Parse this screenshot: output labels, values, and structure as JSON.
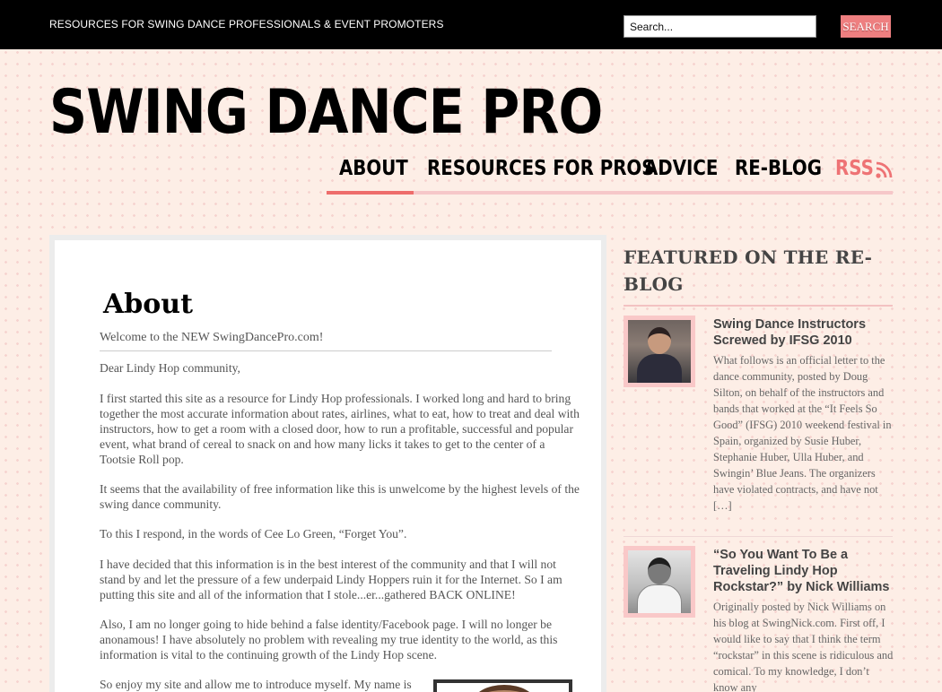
{
  "header": {
    "tagline": "RESOURCES FOR SWING DANCE PROFESSIONALS & EVENT PROMOTERS",
    "search_placeholder": "Search...",
    "search_button": "SEARCH"
  },
  "site": {
    "title": "SWING DANCE PRO"
  },
  "nav": {
    "items": [
      {
        "label": "ABOUT",
        "active": true
      },
      {
        "label": "RESOURCES FOR PROS",
        "active": false
      },
      {
        "label": "ADVICE",
        "active": false
      },
      {
        "label": "RE-BLOG",
        "active": false
      },
      {
        "label": "RSS",
        "active": false
      }
    ],
    "rss_icon": "rss-icon"
  },
  "colors": {
    "accent": "#ee6d6b",
    "nav_rule": "#f6c7c9",
    "background": "#fdeee6"
  },
  "main": {
    "title": "About",
    "intro": "Welcome to the NEW SwingDancePro.com!",
    "paragraphs": [
      "Dear Lindy Hop community,",
      "I first started this site as a resource for Lindy Hop professionals. I worked long and hard to bring together the most accurate information about rates, airlines, what to eat, how to treat and deal with instructors, how to get a room with a closed door, how to run a profitable, successful and popular event, what brand of cereal to snack on and how many licks it takes to get to the center of a Tootsie Roll pop.",
      "It seems that the availability of free information like this is unwelcome by the highest levels of the swing dance community.",
      "To this I respond, in the words of Cee Lo Green, “Forget You”.",
      "I have decided that this information is in the best interest of the community and that I will not stand by and let the pressure of a few underpaid Lindy Hoppers ruin it for the Internet. So I am putting this site and all of the information that I stole...er...gathered BACK ONLINE!",
      "Also, I am no longer going to hide behind a false identity/Facebook page. I will no longer be anonamous! I have absolutely no problem with revealing my true identity to the world, as this information is vital to the continuing growth of the Lindy Hop scene.",
      "So enjoy my site and allow me to introduce myself. My name is"
    ]
  },
  "sidebar": {
    "heading": "FEATURED ON THE RE-BLOG",
    "posts": [
      {
        "title": "Swing Dance Instructors Screwed by IFSG 2010",
        "excerpt": "What follows is an official letter to the dance community, posted by Doug Silton, on behalf of the instructors and bands that worked at the “It Feels So Good” (IFSG) 2010 weekend festival in Spain, organized by Susie Huber, Stephanie Huber, Ulla Huber, and Swingin’ Blue Jeans. The organizers have violated contracts, and have not […]"
      },
      {
        "title": "“So You Want To Be a Traveling Lindy Hop Rockstar?” by Nick Williams",
        "excerpt": "Originally posted by Nick Williams on his blog at SwingNick.com. First off, I would like to say that I think the term “rockstar” in this scene is ridiculous and comical.  To my knowledge, I don’t know any"
      }
    ]
  }
}
